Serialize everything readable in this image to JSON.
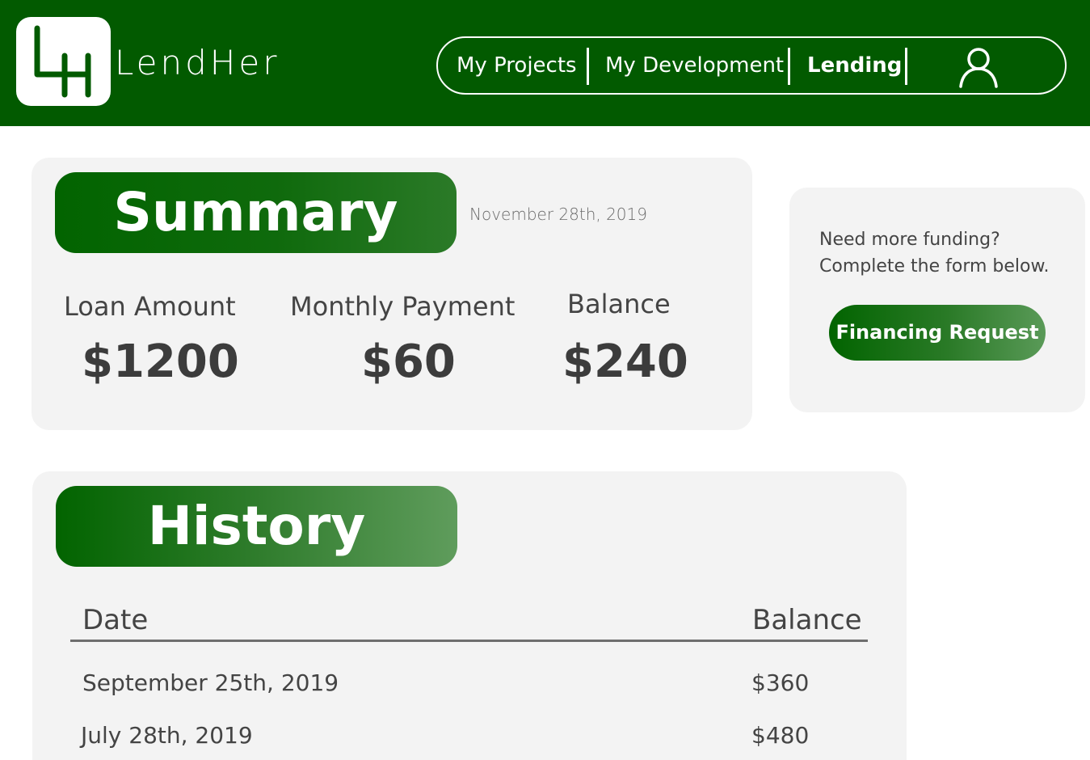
{
  "header": {
    "brand": "LendHer",
    "nav": [
      {
        "label": "My Projects",
        "active": false
      },
      {
        "label": "My Development",
        "active": false
      },
      {
        "label": "Lending",
        "active": true
      }
    ],
    "user_icon": "user-icon",
    "logo_icon": "lh-logo-icon",
    "colors": {
      "header_bg": "#025a00",
      "accent": "#026400"
    }
  },
  "summary": {
    "title": "Summary",
    "date": "November 28th, 2019",
    "stats": [
      {
        "label": "Loan Amount",
        "value": "$1200"
      },
      {
        "label": "Monthly Payment",
        "value": "$60"
      },
      {
        "label": "Balance",
        "value": "$240"
      }
    ]
  },
  "funding": {
    "line1": "Need more funding?",
    "line2": "Complete the form below.",
    "button_label": "Financing Request"
  },
  "history": {
    "title": "History",
    "columns": [
      "Date",
      "Balance"
    ],
    "rows": [
      {
        "date": "September 25th, 2019",
        "balance": "$360"
      },
      {
        "date": "July 28th, 2019",
        "balance": "$480"
      }
    ]
  }
}
